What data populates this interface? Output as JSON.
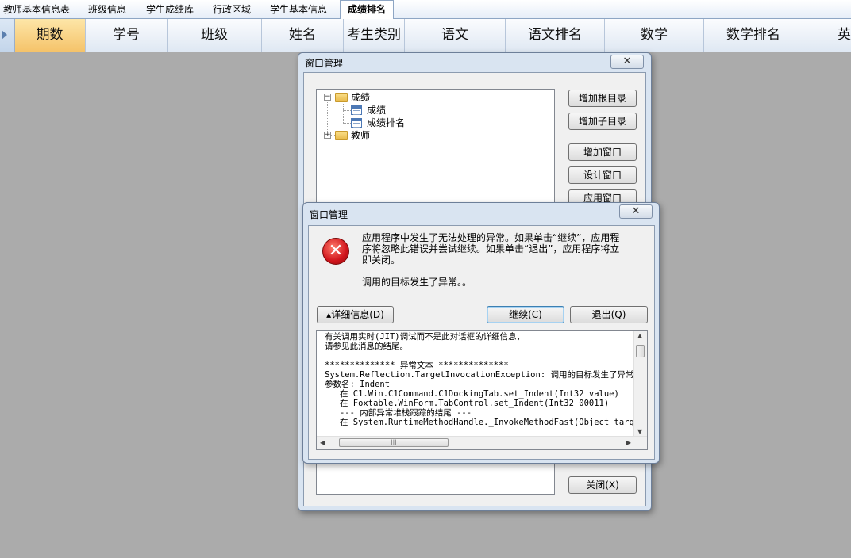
{
  "tabs": [
    {
      "label": "教师基本信息表"
    },
    {
      "label": "班级信息"
    },
    {
      "label": "学生成绩库"
    },
    {
      "label": "行政区域"
    },
    {
      "label": "学生基本信息"
    },
    {
      "label": "成绩排名"
    }
  ],
  "grid_columns": [
    {
      "label": "期数"
    },
    {
      "label": "学号"
    },
    {
      "label": "班级"
    },
    {
      "label": "姓名"
    },
    {
      "label": "考生类别"
    },
    {
      "label": "语文"
    },
    {
      "label": "语文排名"
    },
    {
      "label": "数学"
    },
    {
      "label": "数学排名"
    },
    {
      "label": "英"
    }
  ],
  "window_manager": {
    "title": "窗口管理",
    "close_glyph": "✕",
    "tree": [
      {
        "label": "成绩",
        "expander": "−"
      },
      {
        "label": "成绩"
      },
      {
        "label": "成绩排名"
      },
      {
        "label": "教师",
        "expander": "+"
      }
    ],
    "buttons": {
      "add_root": "增加根目录",
      "add_child": "增加子目录",
      "add_window": "增加窗口",
      "design_window": "设计窗口",
      "apply_window": "应用窗口",
      "close": "关闭(X)"
    }
  },
  "error_dialog": {
    "title": "窗口管理",
    "close_glyph": "✕",
    "icon_glyph": "✕",
    "message_lines": [
      "应用程序中发生了无法处理的异常。如果单击“继续”，应用程",
      "序将忽略此错误并尝试继续。如果单击“退出”，应用程序将立",
      "即关闭。"
    ],
    "message2": "调用的目标发生了异常。。",
    "details_button": "▴详细信息(D)",
    "continue_button": "继续(C)",
    "quit_button": "退出(Q)",
    "detail_lines": [
      "有关调用实时(JIT)调试而不是此对话框的详细信息，",
      "请参见此消息的结尾。",
      "",
      "************** 异常文本 **************",
      "System.Reflection.TargetInvocationException: 调用的目标发生了异常。",
      "参数名: Indent",
      "   在 C1.Win.C1Command.C1DockingTab.set_Indent(Int32 value)",
      "   在 Foxtable.WinForm.TabControl.set_Indent(Int32 00011)",
      "   --- 内部异常堆栈跟踪的结尾 ---",
      "   在 System.RuntimeMethodHandle._InvokeMethodFast(Object target,"
    ],
    "scroll_thumb_glyph": "|||",
    "arrow_up": "▲",
    "arrow_down": "▼",
    "arrow_left": "◀",
    "arrow_right": "▶"
  }
}
